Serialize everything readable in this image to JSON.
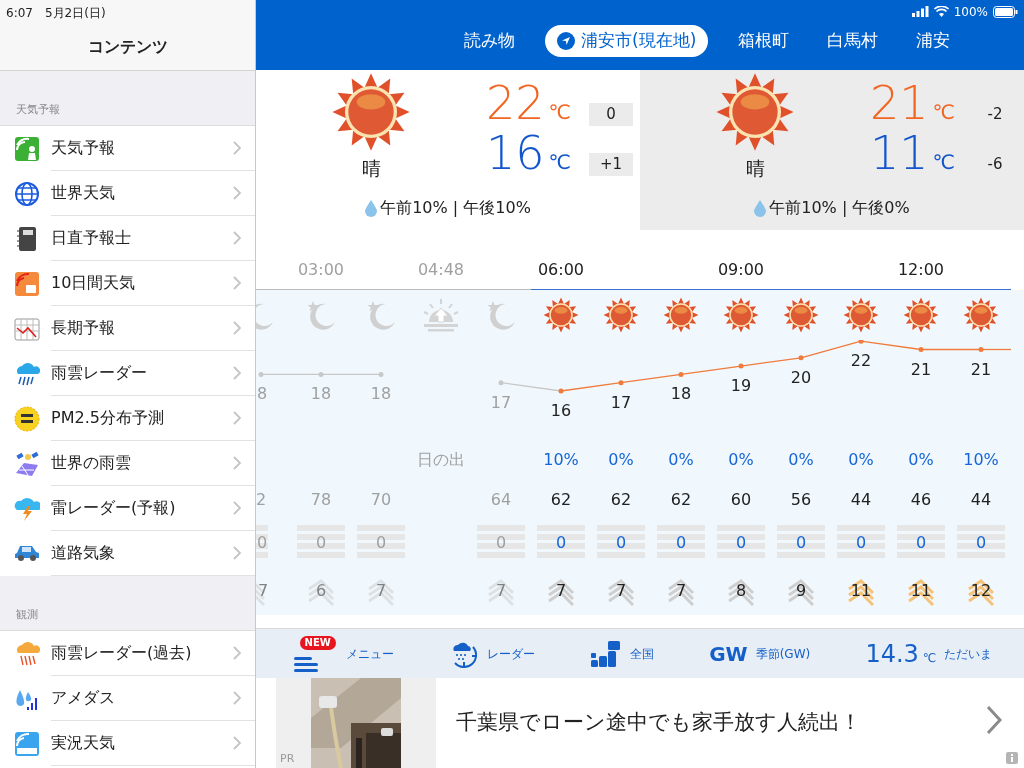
{
  "status_bar": {
    "time": "6:07",
    "date": "5月2日(日)",
    "battery": "100%"
  },
  "sidebar": {
    "title": "コンテンツ",
    "sections": [
      {
        "heading": "天気予報",
        "items": [
          {
            "label": "天気予報"
          },
          {
            "label": "世界天気"
          },
          {
            "label": "日直予報士"
          },
          {
            "label": "10日間天気"
          },
          {
            "label": "長期予報"
          },
          {
            "label": "雨雲レーダー"
          },
          {
            "label": "PM2.5分布予測"
          },
          {
            "label": "世界の雨雲"
          },
          {
            "label": "雷レーダー(予報)"
          },
          {
            "label": "道路気象"
          }
        ]
      },
      {
        "heading": "観測",
        "items": [
          {
            "label": "雨雲レーダー(過去)"
          },
          {
            "label": "アメダス"
          },
          {
            "label": "実況天気"
          }
        ]
      }
    ]
  },
  "location_tabs": [
    {
      "label": "読み物",
      "kind": "text",
      "selected": false
    },
    {
      "label": "浦安市(現在地)",
      "kind": "location",
      "selected": true
    },
    {
      "label": "箱根町",
      "kind": "text",
      "selected": false
    },
    {
      "label": "白馬村",
      "kind": "text",
      "selected": false
    },
    {
      "label": "浦安",
      "kind": "text",
      "selected": false
    }
  ],
  "day_cards": [
    {
      "selected": true,
      "condition": "晴",
      "high": {
        "value": "22",
        "unit": "℃",
        "diff": "0"
      },
      "low": {
        "value": "16",
        "unit": "℃",
        "diff": "+1"
      },
      "precip": "午前10% | 午後10%"
    },
    {
      "selected": false,
      "condition": "晴",
      "high": {
        "value": "21",
        "unit": "℃",
        "diff": "-2"
      },
      "low": {
        "value": "11",
        "unit": "℃",
        "diff": "-6"
      },
      "precip": "午前10% | 午後0%"
    }
  ],
  "hourly": [
    {
      "kind": "night",
      "past": true,
      "partial": true,
      "temp": "8",
      "humidity": "2",
      "rain": "0",
      "wind": "7",
      "strong_wind": false
    },
    {
      "kind": "night",
      "past": true,
      "time": "03:00",
      "temp": "18",
      "humidity": "78",
      "rain": "0",
      "wind": "6",
      "strong_wind": false
    },
    {
      "kind": "night",
      "past": true,
      "temp": "18",
      "humidity": "70",
      "rain": "0",
      "wind": "7",
      "strong_wind": false
    },
    {
      "kind": "sunrise",
      "past": true,
      "time": "04:48",
      "precip": "日の出"
    },
    {
      "kind": "night",
      "past": true,
      "temp": "17",
      "humidity": "64",
      "rain": "0",
      "wind": "7",
      "strong_wind": false
    },
    {
      "kind": "sunny",
      "past": false,
      "time": "06:00",
      "temp": "16",
      "precip": "10%",
      "humidity": "62",
      "rain": "0",
      "wind": "7",
      "strong_wind": false
    },
    {
      "kind": "sunny",
      "past": false,
      "temp": "17",
      "precip": "0%",
      "humidity": "62",
      "rain": "0",
      "wind": "7",
      "strong_wind": false
    },
    {
      "kind": "sunny",
      "past": false,
      "temp": "18",
      "precip": "0%",
      "humidity": "62",
      "rain": "0",
      "wind": "7",
      "strong_wind": false
    },
    {
      "kind": "sunny",
      "past": false,
      "time": "09:00",
      "temp": "19",
      "precip": "0%",
      "humidity": "60",
      "rain": "0",
      "wind": "8",
      "strong_wind": false
    },
    {
      "kind": "sunny",
      "past": false,
      "temp": "20",
      "precip": "0%",
      "humidity": "56",
      "rain": "0",
      "wind": "9",
      "strong_wind": false
    },
    {
      "kind": "sunny",
      "past": false,
      "temp": "22",
      "precip": "0%",
      "humidity": "44",
      "rain": "0",
      "wind": "11",
      "strong_wind": true
    },
    {
      "kind": "sunny",
      "past": false,
      "time": "12:00",
      "temp": "21",
      "precip": "0%",
      "humidity": "46",
      "rain": "0",
      "wind": "11",
      "strong_wind": true
    },
    {
      "kind": "sunny",
      "past": false,
      "temp": "21",
      "precip": "10%",
      "humidity": "44",
      "rain": "0",
      "wind": "12",
      "strong_wind": true
    }
  ],
  "toolbar": [
    {
      "kind": "menu",
      "label": "メニュー",
      "badge": "NEW"
    },
    {
      "kind": "radar",
      "label": "レーダー"
    },
    {
      "kind": "nation",
      "label": "全国"
    },
    {
      "kind": "season",
      "mark": "GW",
      "label": "季節(GW)"
    },
    {
      "kind": "current",
      "value": "14.3",
      "unit": "℃",
      "label": "ただいま"
    }
  ],
  "ad": {
    "tag": "PR",
    "text": "千葉県でローン途中でも家手放す人続出！"
  }
}
